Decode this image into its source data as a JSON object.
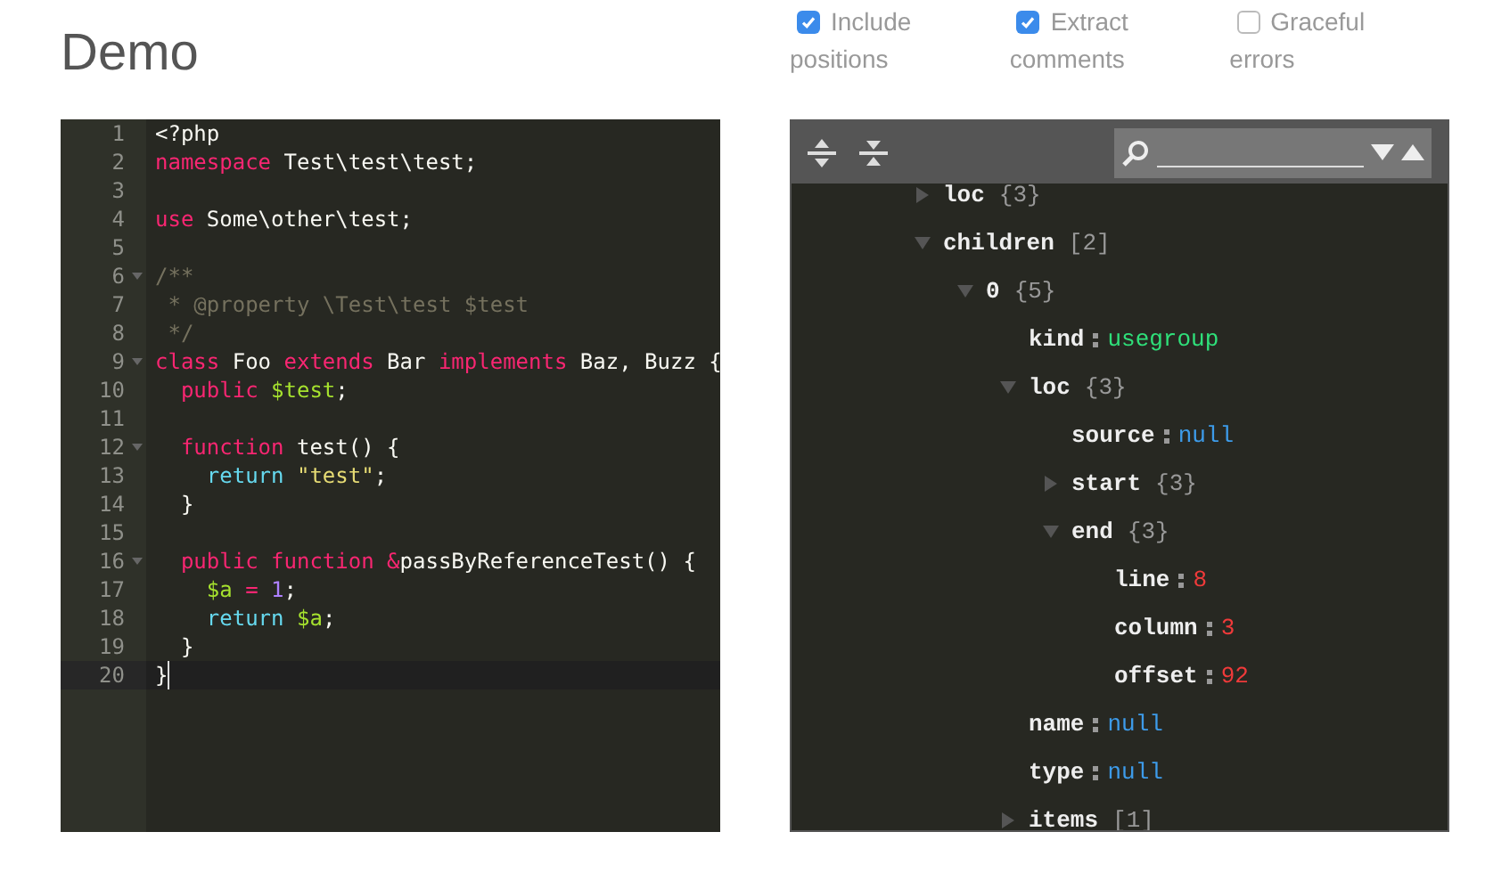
{
  "title": "Demo",
  "options": [
    {
      "label": "Include positions",
      "checked": true
    },
    {
      "label": "Extract comments",
      "checked": true
    },
    {
      "label": "Graceful errors",
      "checked": false
    }
  ],
  "editor": {
    "lines": [
      {
        "number": "1",
        "fold": false,
        "active": false,
        "tokens": [
          {
            "kind": "plain",
            "text": "<?php"
          }
        ]
      },
      {
        "number": "2",
        "fold": false,
        "active": false,
        "tokens": [
          {
            "kind": "keyword",
            "text": "namespace"
          },
          {
            "kind": "plain",
            "text": " Test\\test\\test;"
          }
        ]
      },
      {
        "number": "3",
        "fold": false,
        "active": false
      },
      {
        "number": "4",
        "fold": false,
        "active": false,
        "tokens": [
          {
            "kind": "keyword",
            "text": "use"
          },
          {
            "kind": "plain",
            "text": " Some\\other\\test;"
          }
        ]
      },
      {
        "number": "5",
        "fold": false,
        "active": false
      },
      {
        "number": "6",
        "fold": true,
        "active": false,
        "tokens": [
          {
            "kind": "comment",
            "text": "/**"
          }
        ]
      },
      {
        "number": "7",
        "fold": false,
        "active": false,
        "tokens": [
          {
            "kind": "comment",
            "text": " * @property \\Test\\test $test"
          }
        ]
      },
      {
        "number": "8",
        "fold": false,
        "active": false,
        "tokens": [
          {
            "kind": "comment",
            "text": " */"
          }
        ]
      },
      {
        "number": "9",
        "fold": true,
        "active": false,
        "tokens": [
          {
            "kind": "keyword",
            "text": "class"
          },
          {
            "kind": "plain",
            "text": " Foo "
          },
          {
            "kind": "keyword",
            "text": "extends"
          },
          {
            "kind": "plain",
            "text": " Bar "
          },
          {
            "kind": "keyword",
            "text": "implements"
          },
          {
            "kind": "plain",
            "text": " Baz, Buzz {"
          }
        ]
      },
      {
        "number": "10",
        "fold": false,
        "active": false,
        "tokens": [
          {
            "kind": "keyword",
            "text": "  public "
          },
          {
            "kind": "variable",
            "text": "$test"
          },
          {
            "kind": "plain",
            "text": ";"
          }
        ]
      },
      {
        "number": "11",
        "fold": false,
        "active": false
      },
      {
        "number": "12",
        "fold": true,
        "active": false,
        "tokens": [
          {
            "kind": "keyword",
            "text": "  function"
          },
          {
            "kind": "plain",
            "text": " test() {"
          }
        ]
      },
      {
        "number": "13",
        "fold": false,
        "active": false,
        "tokens": [
          {
            "kind": "builtin",
            "text": "    return "
          },
          {
            "kind": "string",
            "text": "\"test\""
          },
          {
            "kind": "plain",
            "text": ";"
          }
        ]
      },
      {
        "number": "14",
        "fold": false,
        "active": false,
        "tokens": [
          {
            "kind": "plain",
            "text": "  }"
          }
        ]
      },
      {
        "number": "15",
        "fold": false,
        "active": false
      },
      {
        "number": "16",
        "fold": true,
        "active": false,
        "tokens": [
          {
            "kind": "keyword",
            "text": "  public function &"
          },
          {
            "kind": "plain",
            "text": "passByReferenceTest() {"
          }
        ]
      },
      {
        "number": "17",
        "fold": false,
        "active": false,
        "tokens": [
          {
            "kind": "variable",
            "text": "    $a "
          },
          {
            "kind": "keyword",
            "text": "= "
          },
          {
            "kind": "number",
            "text": "1"
          },
          {
            "kind": "plain",
            "text": ";"
          }
        ]
      },
      {
        "number": "18",
        "fold": false,
        "active": false,
        "tokens": [
          {
            "kind": "builtin",
            "text": "    return "
          },
          {
            "kind": "variable",
            "text": "$a"
          },
          {
            "kind": "plain",
            "text": ";"
          }
        ]
      },
      {
        "number": "19",
        "fold": false,
        "active": false,
        "tokens": [
          {
            "kind": "plain",
            "text": "  }"
          }
        ]
      },
      {
        "number": "20",
        "fold": false,
        "active": true,
        "tokens": [
          {
            "kind": "plain",
            "text": "}"
          }
        ]
      }
    ]
  },
  "tree": [
    {
      "key": "loc",
      "summary": "{3}",
      "expanded": false
    },
    {
      "key": "children",
      "summary": "[2]",
      "expanded": true,
      "children": [
        {
          "key": "0",
          "summary": "{5}",
          "expanded": true,
          "children": [
            {
              "key": "kind",
              "value": "usegroup",
              "kind": "string"
            },
            {
              "key": "loc",
              "summary": "{3}",
              "expanded": true,
              "children": [
                {
                  "key": "source",
                  "value": "null",
                  "kind": "null"
                },
                {
                  "key": "start",
                  "summary": "{3}",
                  "expanded": false
                },
                {
                  "key": "end",
                  "summary": "{3}",
                  "expanded": true,
                  "children": [
                    {
                      "key": "line",
                      "value": "8",
                      "kind": "number"
                    },
                    {
                      "key": "column",
                      "value": "3",
                      "kind": "number"
                    },
                    {
                      "key": "offset",
                      "value": "92",
                      "kind": "number"
                    }
                  ]
                }
              ]
            },
            {
              "key": "name",
              "value": "null",
              "kind": "null"
            },
            {
              "key": "type",
              "value": "null",
              "kind": "null"
            },
            {
              "key": "items",
              "summary": "[1]",
              "expanded": false
            }
          ]
        }
      ]
    }
  ]
}
